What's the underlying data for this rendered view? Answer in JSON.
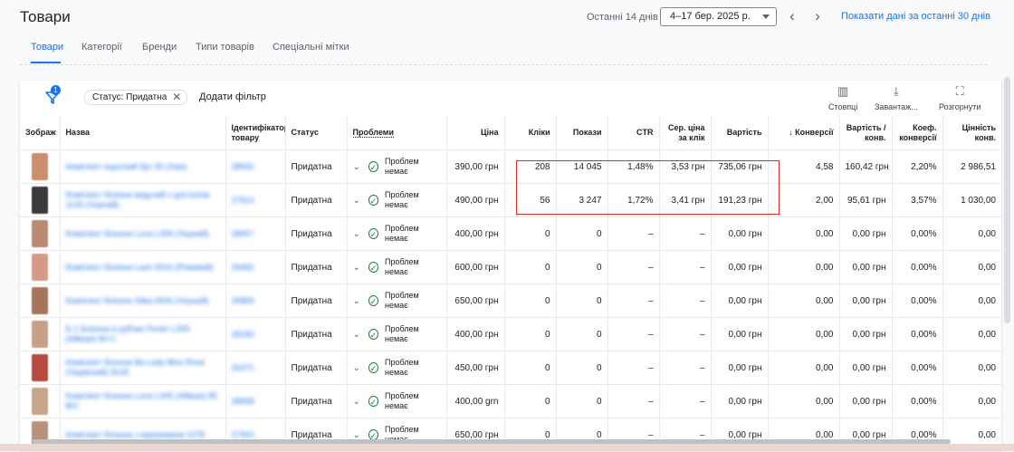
{
  "header": {
    "title": "Товари",
    "range_label": "Останні 14 днів",
    "date_range": "4–17 бер. 2025 р.",
    "prev_arrow": "‹",
    "next_arrow": "›",
    "show_last_link": "Показати дані за останні 30 днів"
  },
  "tabs": [
    {
      "label": "Товари",
      "active": true
    },
    {
      "label": "Категорії",
      "active": false
    },
    {
      "label": "Бренди",
      "active": false
    },
    {
      "label": "Типи товарів",
      "active": false
    },
    {
      "label": "Спеціальні мітки",
      "active": false
    }
  ],
  "filter_bar": {
    "badge_count": "1",
    "chip_label": "Статус: Придатна",
    "add_filter": "Додати фільтр",
    "tools": {
      "columns": "Стовпці",
      "download": "Завантаж...",
      "expand": "Розгорнути"
    }
  },
  "table": {
    "headers": {
      "image": "Зображ",
      "name": "Назва",
      "id": "Ідентифікатор товару",
      "status": "Статус",
      "problems": "Проблеми",
      "price": "Ціна",
      "clicks": "Кліки",
      "impressions": "Покази",
      "ctr": "CTR",
      "avg_cpc": "Сер. ціна за клік",
      "cost": "Вартість",
      "conversions": "↓ Конверсії",
      "cost_per_conv": "Вартість / конв.",
      "conv_rate": "Коеф. конверсії",
      "conv_value": "Цінність конв."
    },
    "rows": [
      {
        "name": "Комплект короткий бус 55 (Хакі)",
        "id": "28592",
        "status": "Придатна",
        "problem": "Проблем немає",
        "price": "390,00 грн",
        "clicks": "208",
        "impressions": "14 045",
        "ctr": "1,48%",
        "avg_cpc": "3,53 грн",
        "cost": "735,06 грн",
        "conversions": "4,58",
        "cost_per_conv": "160,42 грн",
        "conv_rate": "2,20%",
        "conv_value": "2 986,51",
        "thumb": "#c98f6e"
      },
      {
        "name": "Комплект білизни ведучий з доступом 1135 (Чорний)",
        "id": "27814",
        "status": "Придатна",
        "problem": "Проблем немає",
        "price": "490,00 грн",
        "clicks": "56",
        "impressions": "3 247",
        "ctr": "1,72%",
        "avg_cpc": "3,41 грн",
        "cost": "191,23 грн",
        "conversions": "2,00",
        "cost_per_conv": "95,61 грн",
        "conv_rate": "3,57%",
        "conv_value": "1 030,00",
        "thumb": "#3b3b3b"
      },
      {
        "name": "Комплект білизни Luna L306 (Чорний)",
        "id": "28657",
        "status": "Придатна",
        "problem": "Проблем немає",
        "price": "400,00 грн",
        "clicks": "0",
        "impressions": "0",
        "ctr": "–",
        "avg_cpc": "–",
        "cost": "0,00 грн",
        "conversions": "0,00",
        "cost_per_conv": "0,00 грн",
        "conv_rate": "0,00%",
        "conv_value": "0,00",
        "thumb": "#b98a73"
      },
      {
        "name": "Комплект білизни Lace 5016 (Рожевий)",
        "id": "26465",
        "status": "Придатна",
        "problem": "Проблем немає",
        "price": "600,00 грн",
        "clicks": "0",
        "impressions": "0",
        "ctr": "–",
        "avg_cpc": "–",
        "cost": "0,00 грн",
        "conversions": "0,00",
        "cost_per_conv": "0,00 грн",
        "conv_rate": "0,00%",
        "conv_value": "0,00",
        "thumb": "#d59a86"
      },
      {
        "name": "Комплект білизни Silka 5506 (Чорний)",
        "id": "25869",
        "status": "Придатна",
        "problem": "Проблем немає",
        "price": "650,00 грн",
        "clicks": "0",
        "impressions": "0",
        "ctr": "–",
        "avg_cpc": "–",
        "cost": "0,00 грн",
        "conversions": "0,00",
        "cost_per_conv": "0,00 грн",
        "conv_rate": "0,00%",
        "conv_value": "0,00",
        "thumb": "#a5755c"
      },
      {
        "name": "Б-1 Білизна в рубчик Попит L305 (Айворі) 80-C",
        "id": "28183",
        "status": "Придатна",
        "problem": "Проблем немає",
        "price": "400,00 грн",
        "clicks": "0",
        "impressions": "0",
        "ctr": "–",
        "avg_cpc": "–",
        "cost": "0,00 грн",
        "conversions": "0,00",
        "cost_per_conv": "0,00 грн",
        "conv_rate": "0,00%",
        "conv_value": "0,00",
        "thumb": "#c7a08a"
      },
      {
        "name": "Комплект білизни Ва Lady Miss Rose (Червоний) 5018",
        "id": "26371",
        "status": "Придатна",
        "problem": "Проблем немає",
        "price": "450,00 грн",
        "clicks": "0",
        "impressions": "0",
        "ctr": "–",
        "avg_cpc": "–",
        "cost": "0,00 грн",
        "conversions": "0,00",
        "cost_per_conv": "0,00 грн",
        "conv_rate": "0,00%",
        "conv_value": "0,00",
        "thumb": "#b84a3f"
      },
      {
        "name": "Комплект білизни Luna L305 (Айворі) 85 B/C",
        "id": "28658",
        "status": "Придатна",
        "problem": "Проблем немає",
        "price": "400,00 grn",
        "clicks": "0",
        "impressions": "0",
        "ctr": "–",
        "avg_cpc": "–",
        "cost": "0,00 грн",
        "conversions": "0,00",
        "cost_per_conv": "0,00 грн",
        "conv_rate": "0,00%",
        "conv_value": "0,00",
        "thumb": "#c9a48c"
      },
      {
        "name": "Комплект білизни з мереживом 1078",
        "id": "27903",
        "status": "Придатна",
        "problem": "Проблем немає",
        "price": "650,00 грн",
        "clicks": "0",
        "impressions": "0",
        "ctr": "–",
        "avg_cpc": "–",
        "cost": "0,00 грн",
        "conversions": "0,00",
        "cost_per_conv": "0,00 грн",
        "conv_rate": "0,00%",
        "conv_value": "0,00",
        "thumb": "#b8927a"
      }
    ]
  },
  "colors": {
    "accent": "#1a73e8",
    "highlight_box": "#d93025",
    "ok_green": "#188038"
  }
}
